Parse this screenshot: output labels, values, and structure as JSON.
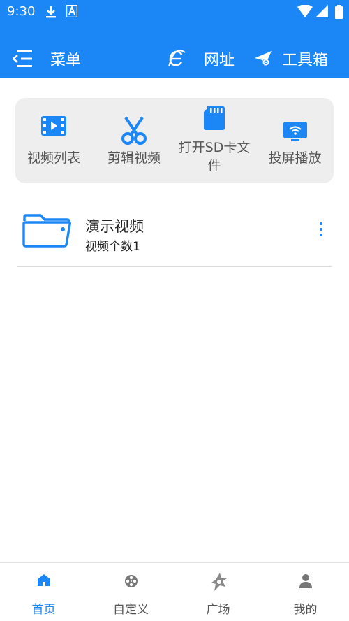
{
  "status_bar": {
    "time": "9:30"
  },
  "app_bar": {
    "menu_label": "菜单",
    "url_label": "网址",
    "tools_label": "工具箱"
  },
  "quick_actions": [
    {
      "label": "视频列表",
      "icon": "video-list-icon"
    },
    {
      "label": "剪辑视频",
      "icon": "scissors-icon"
    },
    {
      "label": "打开SD卡文件",
      "icon": "sd-card-icon"
    },
    {
      "label": "投屏播放",
      "icon": "cast-screen-icon"
    }
  ],
  "folder": {
    "title": "演示视频",
    "subtitle": "视频个数1"
  },
  "bottom_nav": {
    "tabs": [
      {
        "label": "首页",
        "icon": "home-icon",
        "active": true
      },
      {
        "label": "自定义",
        "icon": "film-reel-icon",
        "active": false
      },
      {
        "label": "广场",
        "icon": "plaza-icon",
        "active": false
      },
      {
        "label": "我的",
        "icon": "user-icon",
        "active": false
      }
    ]
  },
  "colors": {
    "primary": "#1b86f5",
    "card_bg": "#eeeeee",
    "inactive": "#555555"
  }
}
